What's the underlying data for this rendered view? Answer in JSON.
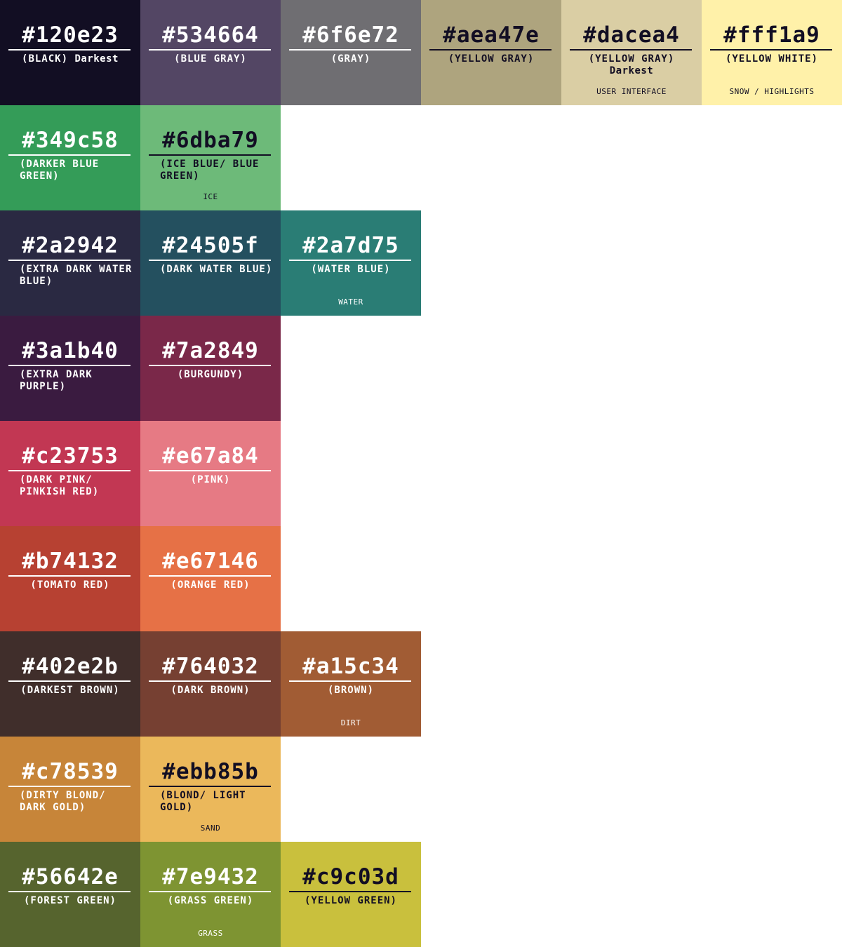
{
  "rows": [
    [
      {
        "hex": "#120e23",
        "name": "(BLACK)",
        "name_suffix": "Darkest",
        "usage": "",
        "color": "#120e23",
        "text": "light"
      },
      {
        "hex": "#534664",
        "name": "(BLUE GRAY)",
        "usage": "",
        "color": "#534664",
        "text": "light"
      },
      {
        "hex": "#6f6e72",
        "name": "(GRAY)",
        "usage": "",
        "color": "#6f6e72",
        "text": "light"
      },
      {
        "hex": "#aea47e",
        "name": "(YELLOW GRAY)",
        "usage": "",
        "color": "#aea47e",
        "text": "dark"
      },
      {
        "hex": "#dacea4",
        "name": "(YELLOW GRAY)",
        "name_line2": "Darkest",
        "usage": "USER INTERFACE",
        "color": "#dacea4",
        "text": "dark"
      },
      {
        "hex": "#fff1a9",
        "name": "(YELLOW WHITE)",
        "usage": "SNOW / HIGHLIGHTS",
        "color": "#fff1a9",
        "text": "dark"
      }
    ],
    [
      {
        "hex": "#349c58",
        "name": "(DARKER BLUE GREEN)",
        "usage": "",
        "color": "#349c58",
        "text": "light"
      },
      {
        "hex": "#6dba79",
        "name": "(ICE BLUE/ BLUE GREEN)",
        "usage": "ICE",
        "color": "#6dba79",
        "text": "dark"
      }
    ],
    [
      {
        "hex": "#2a2942",
        "name": "(EXTRA DARK WATER BLUE)",
        "usage": "",
        "color": "#2a2942",
        "text": "light"
      },
      {
        "hex": "#24505f",
        "name": "(DARK WATER BLUE)",
        "usage": "",
        "color": "#24505f",
        "text": "light"
      },
      {
        "hex": "#2a7d75",
        "name": "(WATER BLUE)",
        "usage": "WATER",
        "color": "#2a7d75",
        "text": "light"
      }
    ],
    [
      {
        "hex": "#3a1b40",
        "name": "(EXTRA DARK PURPLE)",
        "usage": "",
        "color": "#3a1b40",
        "text": "light"
      },
      {
        "hex": "#7a2849",
        "name": "(BURGUNDY)",
        "usage": "",
        "color": "#7a2849",
        "text": "light"
      }
    ],
    [
      {
        "hex": "#c23753",
        "name": "(DARK PINK/ PINKISH RED)",
        "usage": "",
        "color": "#c23753",
        "text": "light"
      },
      {
        "hex": "#e67a84",
        "name": "(PINK)",
        "usage": "",
        "color": "#e67a84",
        "text": "light"
      }
    ],
    [
      {
        "hex": "#b74132",
        "name": "(TOMATO RED)",
        "usage": "",
        "color": "#b74132",
        "text": "light"
      },
      {
        "hex": "#e67146",
        "name": "(ORANGE RED)",
        "usage": "",
        "color": "#e67146",
        "text": "light"
      }
    ],
    [
      {
        "hex": "#402e2b",
        "name": "(DARKEST BROWN)",
        "usage": "",
        "color": "#402e2b",
        "text": "light"
      },
      {
        "hex": "#764032",
        "name": "(DARK BROWN)",
        "usage": "",
        "color": "#764032",
        "text": "light"
      },
      {
        "hex": "#a15c34",
        "name": "(BROWN)",
        "usage": "DIRT",
        "color": "#a15c34",
        "text": "light"
      }
    ],
    [
      {
        "hex": "#c78539",
        "name": "(DIRTY BLOND/ DARK GOLD)",
        "usage": "",
        "color": "#c78539",
        "text": "light"
      },
      {
        "hex": "#ebb85b",
        "name": "(BLOND/ LIGHT GOLD)",
        "usage": "SAND",
        "color": "#ebb85b",
        "text": "dark"
      }
    ],
    [
      {
        "hex": "#56642e",
        "name": "(FOREST GREEN)",
        "usage": "",
        "color": "#56642e",
        "text": "light"
      },
      {
        "hex": "#7e9432",
        "name": "(GRASS GREEN)",
        "usage": "GRASS",
        "color": "#7e9432",
        "text": "light"
      },
      {
        "hex": "#c9c03d",
        "name": "(YELLOW GREEN)",
        "usage": "",
        "color": "#c9c03d",
        "text": "dark"
      }
    ]
  ]
}
